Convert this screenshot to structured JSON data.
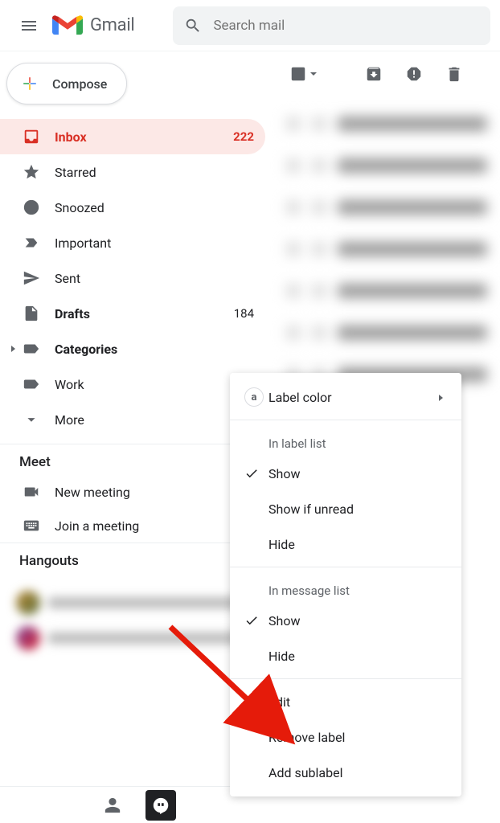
{
  "header": {
    "app_name": "Gmail",
    "search_placeholder": "Search mail"
  },
  "compose_label": "Compose",
  "nav": {
    "inbox": {
      "label": "Inbox",
      "count": "222"
    },
    "starred": {
      "label": "Starred"
    },
    "snoozed": {
      "label": "Snoozed"
    },
    "important": {
      "label": "Important"
    },
    "sent": {
      "label": "Sent"
    },
    "drafts": {
      "label": "Drafts",
      "count": "184"
    },
    "categories": {
      "label": "Categories"
    },
    "work": {
      "label": "Work"
    },
    "more": {
      "label": "More"
    }
  },
  "meet": {
    "title": "Meet",
    "new_meeting": "New meeting",
    "join_meeting": "Join a meeting"
  },
  "hangouts": {
    "title": "Hangouts"
  },
  "context_menu": {
    "label_color": "Label color",
    "in_label_list": "In label list",
    "show": "Show",
    "show_if_unread": "Show if unread",
    "hide": "Hide",
    "in_message_list": "In message list",
    "show2": "Show",
    "hide2": "Hide",
    "edit": "Edit",
    "remove_label": "Remove label",
    "add_sublabel": "Add sublabel",
    "badge_letter": "a"
  }
}
